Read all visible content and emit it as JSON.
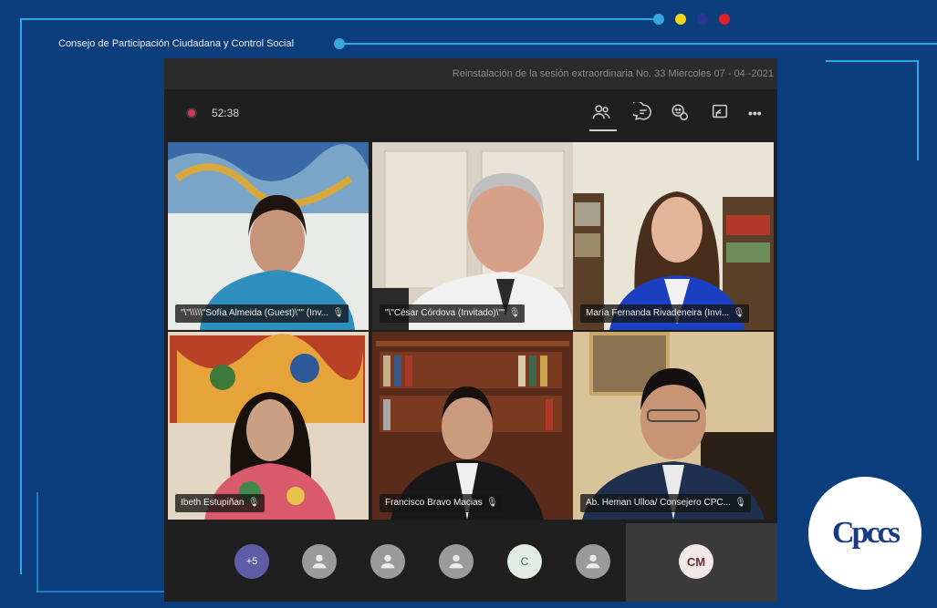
{
  "org": {
    "title": "Consejo de Participación Ciudadana y Control Social"
  },
  "colors": {
    "accent_line": "#2aa7e8",
    "dot_blue": "#3aa6e0",
    "dot_yellow": "#f2d41a",
    "dot_navy": "#2b3590",
    "dot_red": "#e0202a"
  },
  "meeting": {
    "title": "Reinstalación de la sesión extraordinaria No. 33 Miércoles 07 - 04 -2021",
    "timer": "52:38",
    "toolbar_icons": [
      "participants-icon",
      "chat-icon",
      "reactions-icon",
      "share-icon",
      "more-options-icon"
    ],
    "more_label": "•••"
  },
  "participants": [
    {
      "name": "\"\\\"\\\\\\\\\\\"Sofía Almeida (Guest)\\\"\" (Inv...",
      "mic": "muted"
    },
    {
      "name": "\"\\\"César Córdova (Invitado)\\\"\"",
      "mic": "muted"
    },
    {
      "name": "María Fernanda Rivadeneira (Invi...",
      "mic": "muted"
    },
    {
      "name": "Ibeth Estupiñan",
      "mic": "muted"
    },
    {
      "name": "Francisco Bravo Macias",
      "mic": "muted"
    },
    {
      "name": "Ab. Heman Ulloa/ Consejero CPC...",
      "mic": "muted"
    }
  ],
  "bottom": {
    "more_count": "+5",
    "letter_avatar": "C",
    "cm_initials": "CM"
  },
  "logo": {
    "text": "Cpccs"
  }
}
